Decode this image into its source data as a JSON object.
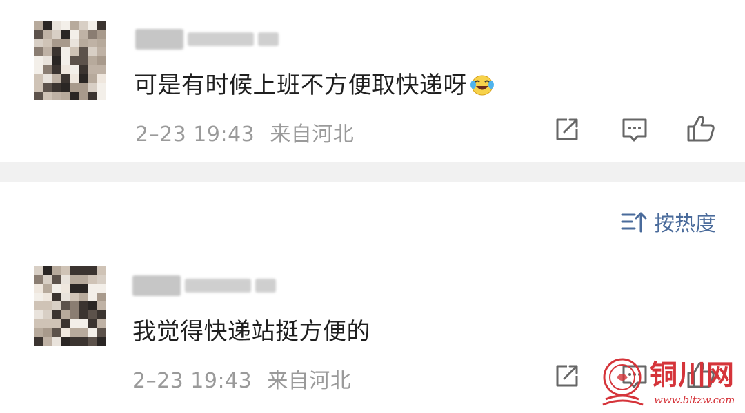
{
  "comments": [
    {
      "text": "可是有时候上班不方便取快递呀",
      "emoji": "laughing-crying-emoji",
      "date": "2–23 19:43",
      "location": "来自河北"
    },
    {
      "text": "我觉得快递站挺方便的",
      "date": "2–23 19:43",
      "location": "来自河北"
    }
  ],
  "sort": {
    "label": "按热度"
  },
  "watermark": {
    "name": "铜川网",
    "url": "www.bltzw.com"
  },
  "colors": {
    "accent": "#4a6b9b",
    "meta": "#9a9a9a",
    "divider": "#f1f1f1",
    "watermark": "#d5343a"
  },
  "icons": [
    "share-icon",
    "comment-icon",
    "like-icon",
    "sort-icon"
  ]
}
